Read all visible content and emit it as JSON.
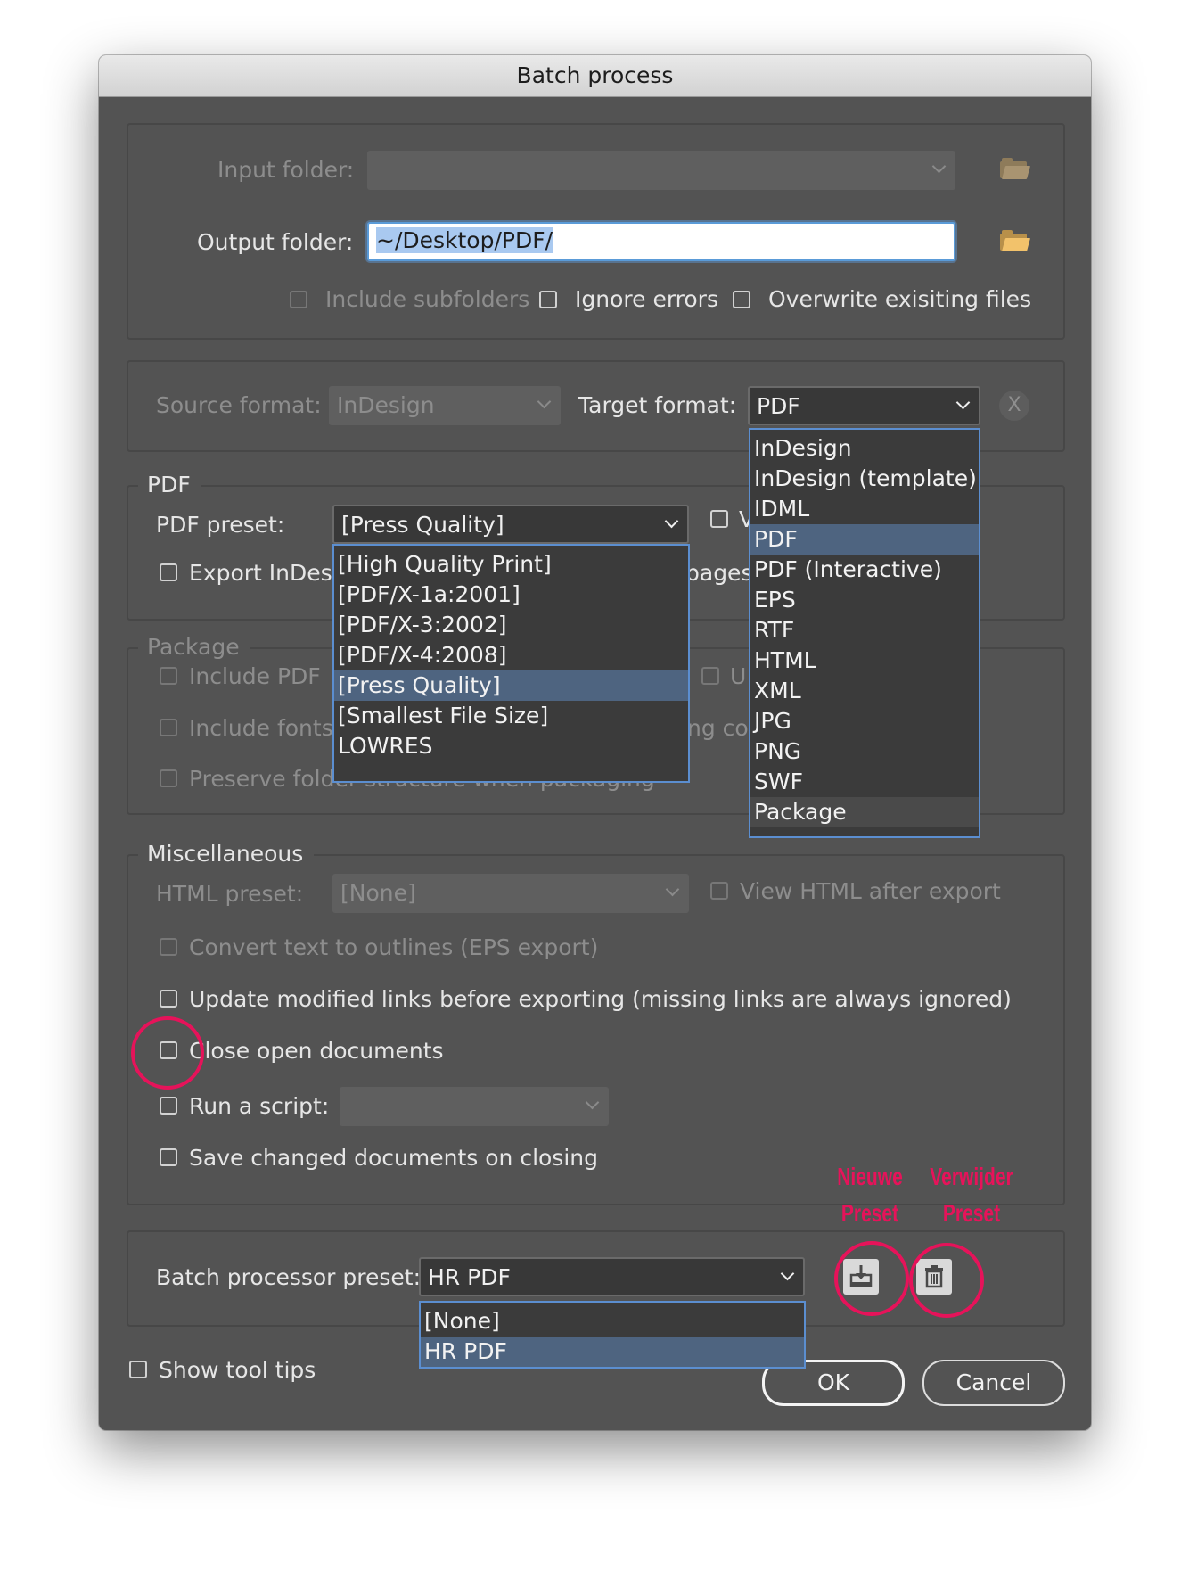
{
  "window": {
    "title": "Batch process"
  },
  "io": {
    "input_folder_label": "Input folder:",
    "output_folder_label": "Output folder:",
    "output_folder_value": "~/Desktop/PDF/",
    "include_subfolders": "Include subfolders",
    "ignore_errors": "Ignore errors",
    "overwrite_files": "Overwrite exisiting files"
  },
  "format": {
    "source_label": "Source format:",
    "source_value": "InDesign",
    "target_label": "Target format:",
    "target_value": "PDF",
    "clear_glyph": "X",
    "target_options": [
      "InDesign",
      "InDesign (template)",
      "IDML",
      "PDF",
      "PDF (Interactive)",
      "EPS",
      "RTF",
      "HTML",
      "XML",
      "JPG",
      "PNG",
      "SWF",
      "Package"
    ],
    "target_selected": "PDF"
  },
  "pdf": {
    "legend": "PDF",
    "preset_label": "PDF preset:",
    "preset_value": "[Press Quality]",
    "view_checkbox_partial": "V",
    "export_partial": "Export InDesi",
    "pages_partial": "pages",
    "preset_options": [
      "[High Quality Print]",
      "[PDF/X-1a:2001]",
      "[PDF/X-3:2002]",
      "[PDF/X-4:2008]",
      "[Press Quality]",
      "[Smallest File Size]",
      "LOWRES"
    ],
    "preset_selected": "[Press Quality]"
  },
  "package": {
    "legend": "Package",
    "include_pdf": "Include PDF",
    "include_fonts": "Include fonts",
    "preserve_partial": "Preserve folder structure when packaging",
    "u_partial": "U",
    "ng_partial": "ng co"
  },
  "misc": {
    "legend": "Miscellaneous",
    "html_preset_label": "HTML preset:",
    "html_preset_value": "[None]",
    "view_html": "View HTML after export",
    "convert_outlines": "Convert text to outlines (EPS export)",
    "update_links": "Update modified links before exporting (missing links are always ignored)",
    "close_docs": "Close open documents",
    "run_script": "Run a script:",
    "save_changed": "Save changed documents on closing"
  },
  "preset": {
    "label": "Batch processor preset:",
    "value": "HR PDF",
    "options": [
      "[None]",
      "HR PDF"
    ],
    "selected": "HR PDF"
  },
  "footer": {
    "show_tooltips": "Show tool tips",
    "ok": "OK",
    "cancel": "Cancel"
  },
  "annotations": {
    "new_preset_line1": "Nieuwe",
    "new_preset_line2": "Preset",
    "delete_preset_line1": "Verwijder",
    "delete_preset_line2": "Preset",
    "color": "#e6135a"
  }
}
